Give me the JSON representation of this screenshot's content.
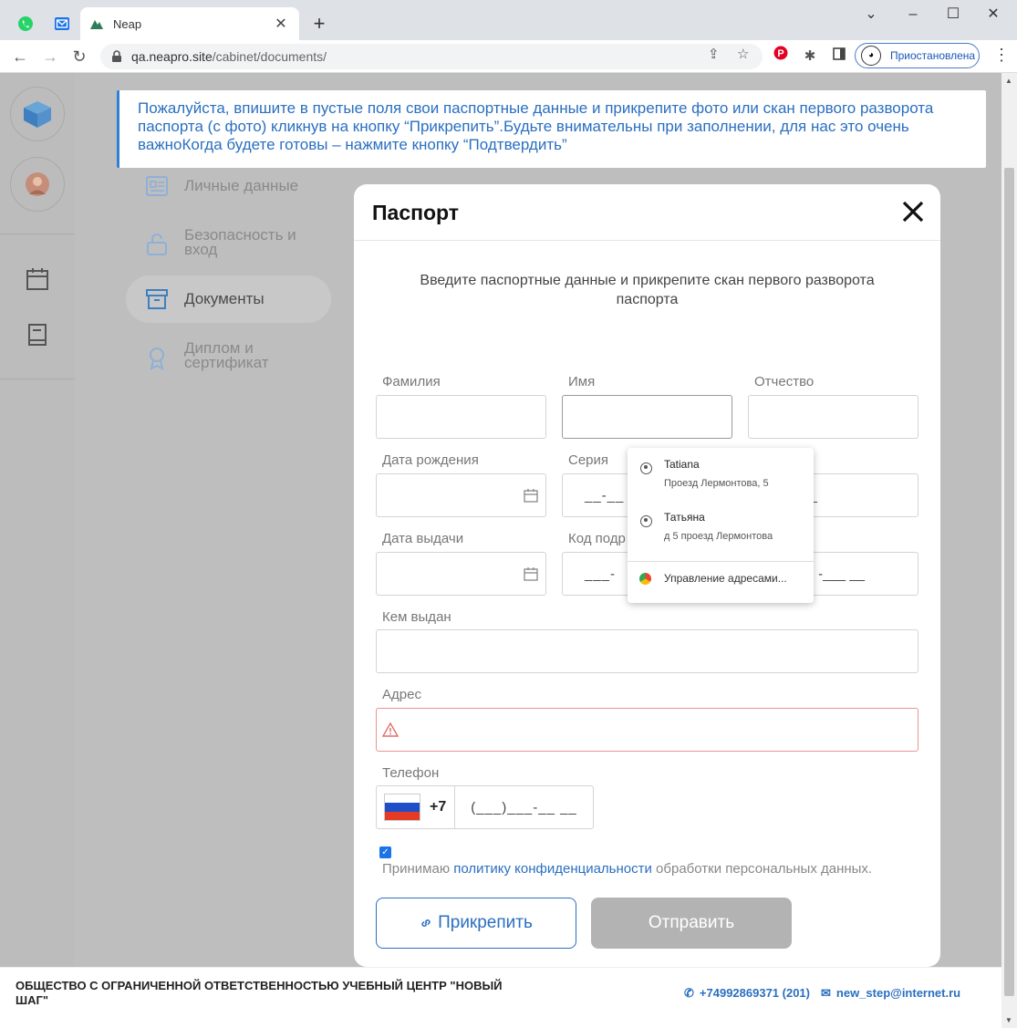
{
  "browser": {
    "tab_title": "Neap",
    "url_host": "qa.neapro.site",
    "url_path": "/cabinet/documents/",
    "profile_status": "Приостановлена"
  },
  "notice": {
    "text": "Пожалуйста, впишите в пустые поля свои паспортные данные и прикрепите фото или скан первого разворота паспорта (с фото) кликнув на кнопку “Прикрепить”.Будьте внимательны при заполнении, для нас это очень важноКогда будете готовы – нажмите кнопку “Подтвердить”"
  },
  "side_menu": {
    "items": [
      {
        "label": "Личные данные"
      },
      {
        "label": "Безопасность и вход"
      },
      {
        "label": "Документы"
      },
      {
        "label": "Диплом и сертификат"
      }
    ]
  },
  "modal": {
    "title": "Паспорт",
    "subtitle": "Введите паспортные данные и прикрепите скан первого разворота паспорта",
    "fields": {
      "surname": "Фамилия",
      "name": "Имя",
      "patronymic": "Отчество",
      "birthdate": "Дата рождения",
      "series": "Серия",
      "issue_date": "Дата выдачи",
      "division_code": "Код подр",
      "issued_by": "Кем выдан",
      "address": "Адрес",
      "phone": "Телефон"
    },
    "masks": {
      "series": "__-__",
      "number": "__",
      "division_left": "___-",
      "division_right": "-___ __",
      "phone_code": "+7",
      "phone": "(___)___-__ __"
    },
    "consent": {
      "prefix": "Принимаю ",
      "link": "политику конфиденциальности",
      "suffix": " обработки персональных данных.",
      "checked": true
    },
    "attach_button": "Прикрепить",
    "send_button": "Отправить"
  },
  "autofill": {
    "items": [
      {
        "name": "Tatiana",
        "address": "Проезд Лермонтова, 5"
      },
      {
        "name": "Татьяна",
        "address": "д 5 проезд Лермонтова"
      }
    ],
    "manage": "Управление адресами..."
  },
  "footer": {
    "org": "ОБЩЕСТВО С ОГРАНИЧЕННОЙ ОТВЕТСТВЕННОСТЬЮ УЧЕБНЫЙ ЦЕНТР \"НОВЫЙ ШАГ\"",
    "phone": "+74992869371 (201)",
    "email": "new_step@internet.ru"
  },
  "colors": {
    "accent": "#2a6fc0",
    "overlay": "#bebebe",
    "error": "#e8948f"
  }
}
